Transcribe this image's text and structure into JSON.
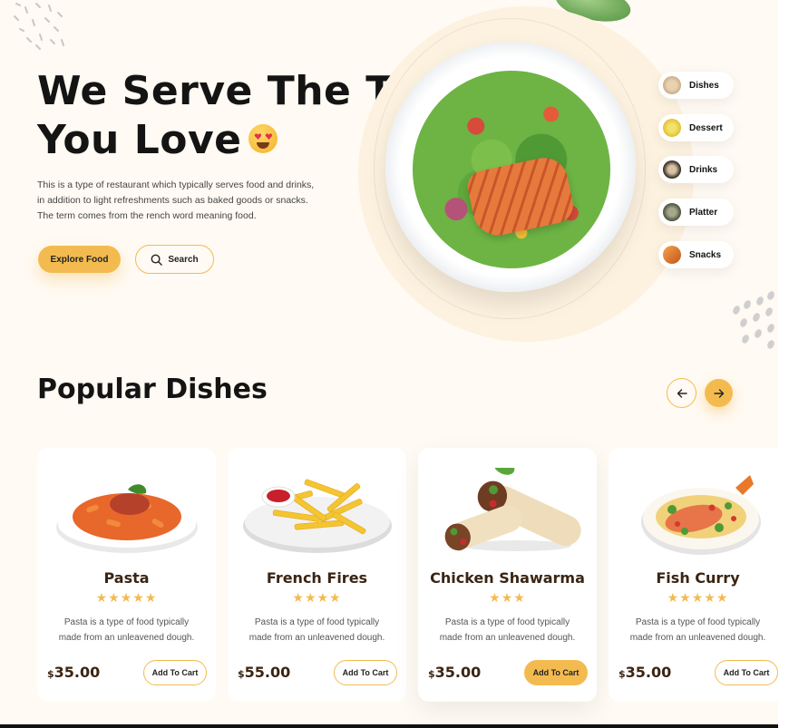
{
  "hero": {
    "title_line1": "We Serve The Test",
    "title_line2": "You Love",
    "description": "This is a type of restaurant which typically serves food and drinks, in addition to light refreshments such as baked goods or snacks. The term comes from the rench word meaning food.",
    "explore_label": "Explore Food",
    "search_label": "Search"
  },
  "categories": [
    {
      "label": "Dishes",
      "color": "#c9a67a"
    },
    {
      "label": "Dessert",
      "color": "#e6c21f"
    },
    {
      "label": "Drinks",
      "color": "#3b3229"
    },
    {
      "label": "Platter",
      "color": "#4a5a40"
    },
    {
      "label": "Snacks",
      "color": "#e07a2b"
    }
  ],
  "popular": {
    "title": "Popular Dishes",
    "dishes": [
      {
        "name": "Pasta",
        "stars": "★★★★★",
        "desc": "Pasta is a type of food typically made from an unleavened dough.",
        "currency": "$",
        "amount": "35.00",
        "cart_label": "Add To Cart",
        "rating": 5
      },
      {
        "name": "French Fires",
        "stars": "★★★★",
        "desc": "Pasta is a type of food typically made from an unleavened dough.",
        "currency": "$",
        "amount": "55.00",
        "cart_label": "Add To Cart",
        "rating": 4
      },
      {
        "name": "Chicken Shawarma",
        "stars": "★★★",
        "desc": "Pasta is a type of food typically made from an unleavened dough.",
        "currency": "$",
        "amount": "35.00",
        "cart_label": "Add To Cart",
        "rating": 3
      },
      {
        "name": "Fish Curry",
        "stars": "★★★★★",
        "desc": "Pasta is a type of food typically made from an unleavened dough.",
        "currency": "$",
        "amount": "35.00",
        "cart_label": "Add To Cart",
        "rating": 5
      }
    ]
  },
  "colors": {
    "accent": "#f3bb4f",
    "background": "#fffaf3",
    "text_dark": "#141414",
    "brown": "#3a2513"
  },
  "icons": {
    "search": "search-icon",
    "prev": "arrow-left-icon",
    "next": "arrow-right-icon",
    "emoji": "heart-eyes-emoji-icon"
  }
}
